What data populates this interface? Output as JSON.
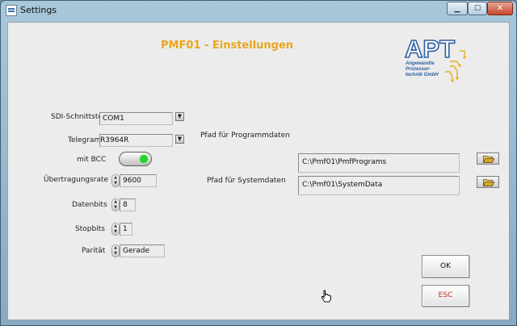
{
  "window": {
    "title": "Settings",
    "app_icon": "settings-window-icon",
    "controls": [
      "minimize-icon",
      "maximize-icon",
      "close-icon"
    ]
  },
  "heading": "PMF01 - Einstellungen",
  "logo": {
    "letters": "APT",
    "tagline": [
      "Angewandte",
      "Prozessor-",
      "technik GmbH"
    ],
    "color": "#2d5fa0",
    "accent": "#e3b024"
  },
  "serial": {
    "interface_label": "SDI-Schnittstelle",
    "interface_value": "COM1",
    "telegram_label": "Telegramm",
    "telegram_value": "R3964R",
    "bcc_label": "mit BCC",
    "bcc_on": true,
    "baud_label": "Übertragungsrate",
    "baud_value": "9600",
    "databits_label": "Datenbits",
    "databits_value": "8",
    "stopbits_label": "Stopbits",
    "stopbits_value": "1",
    "parity_label": "Parität",
    "parity_value": "Gerade"
  },
  "paths": {
    "program_label": "Pfad für Programmdaten",
    "program_value": "C:\\Pmf01\\PmfPrograms",
    "system_label": "Pfad für Systemdaten",
    "system_value": "C:\\Pmf01\\SystemData"
  },
  "buttons": {
    "ok": "OK",
    "esc": "ESC"
  },
  "colors": {
    "heading": "#e9a61c",
    "esc_text": "#c03020",
    "led_on": "#2bd02b"
  }
}
